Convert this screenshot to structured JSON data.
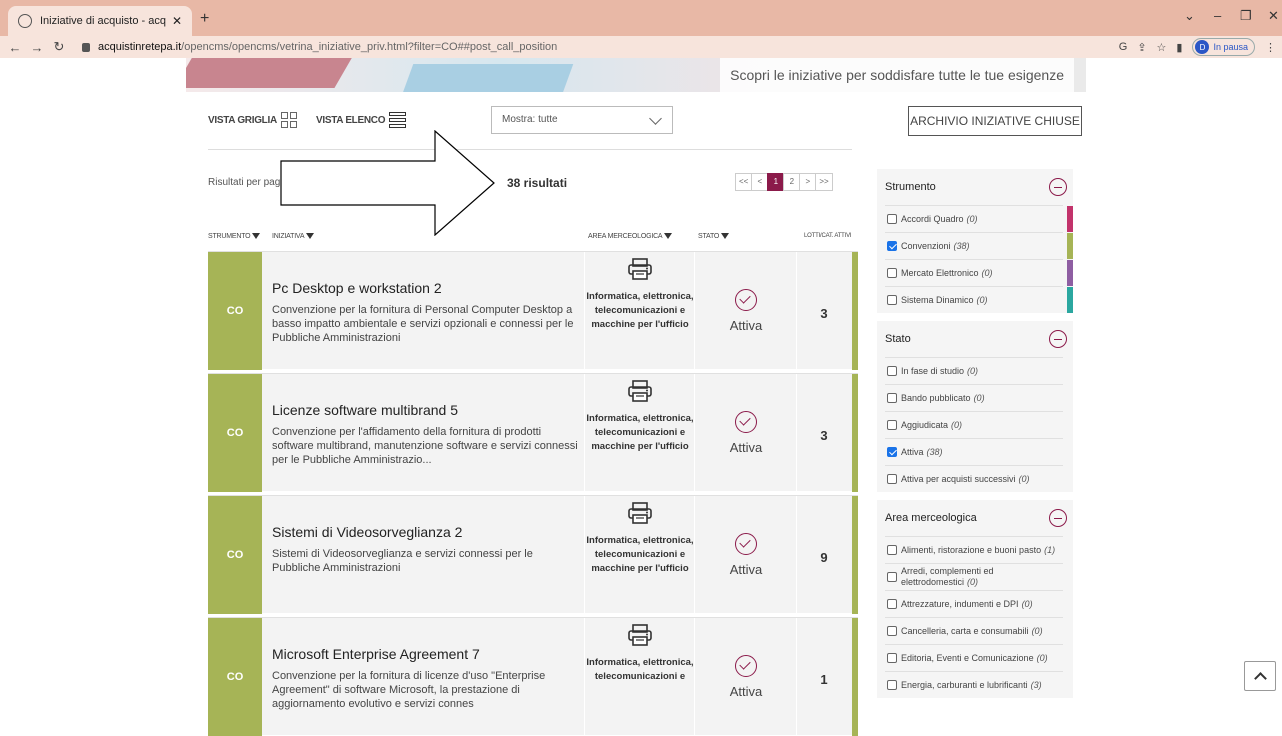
{
  "browser": {
    "tab_title": "Iniziative di acquisto - acquistinr",
    "tab_close": "✕",
    "new_tab": "+",
    "url_host": "acquistinretepa.it",
    "url_rest": "/opencms/opencms/vetrina_iniziative_priv.html?filter=CO##post_call_position",
    "profile_initial": "D",
    "profile_status": "In pausa"
  },
  "hero": {
    "text": "Scopri le iniziative per soddisfare tutte le tue esigenze"
  },
  "toolbar": {
    "vista_griglia": "VISTA GRIGLIA",
    "vista_elenco": "VISTA ELENCO",
    "mostra": "Mostra: tutte",
    "archivio": "ARCHIVIO INIZIATIVE CHIUSE"
  },
  "results": {
    "per_page": "Risultati per pagi",
    "count": "38 risultati",
    "pager": [
      "<<",
      "<",
      "1",
      "2",
      ">",
      ">>"
    ],
    "current_page": "1"
  },
  "table": {
    "headers": {
      "strumento": "STRUMENTO",
      "iniziativa": "INIZIATIVA",
      "area": "AREA MERCEOLOGICA",
      "stato": "STATO",
      "lotti": "LOTTI/CAT. ATTIVI"
    },
    "rows": [
      {
        "strumento": "CO",
        "title": "Pc Desktop e workstation 2",
        "desc": "Convenzione per la fornitura di Personal Computer Desktop a basso impatto ambientale e servizi opzionali e connessi per le Pubbliche Amministrazioni",
        "area": "Informatica, elettronica, telecomunicazioni e macchine per l'ufficio",
        "stato": "Attiva",
        "lotti": "3"
      },
      {
        "strumento": "CO",
        "title": "Licenze software multibrand 5",
        "desc": "Convenzione per l'affidamento della fornitura di prodotti software multibrand, manutenzione software e servizi connessi per le Pubbliche Amministrazio...",
        "area": "Informatica, elettronica, telecomunicazioni e macchine per l'ufficio",
        "stato": "Attiva",
        "lotti": "3"
      },
      {
        "strumento": "CO",
        "title": "Sistemi di Videosorveglianza 2",
        "desc": "Sistemi di Videosorveglianza e servizi connessi per le Pubbliche Amministrazioni",
        "area": "Informatica, elettronica, telecomunicazioni e macchine per l'ufficio",
        "stato": "Attiva",
        "lotti": "9"
      },
      {
        "strumento": "CO",
        "title": "Microsoft Enterprise Agreement 7",
        "desc": "Convenzione per la fornitura di licenze d'uso \"Enterprise Agreement\" di software Microsoft, la prestazione di aggiornamento evolutivo e servizi connes",
        "area": "Informatica, elettronica, telecomunicazioni e",
        "stato": "Attiva",
        "lotti": "1"
      }
    ]
  },
  "filters": {
    "strumento": {
      "title": "Strumento",
      "items": [
        {
          "label": "Accordi Quadro",
          "count": "(0)",
          "checked": false,
          "color": "#c2336b"
        },
        {
          "label": "Convenzioni",
          "count": "(38)",
          "checked": true,
          "color": "#a6b456"
        },
        {
          "label": "Mercato Elettronico",
          "count": "(0)",
          "checked": false,
          "color": "#8e5ea2"
        },
        {
          "label": "Sistema Dinamico",
          "count": "(0)",
          "checked": false,
          "color": "#2ba7a0"
        }
      ]
    },
    "stato": {
      "title": "Stato",
      "items": [
        {
          "label": "In fase di studio",
          "count": "(0)",
          "checked": false
        },
        {
          "label": "Bando pubblicato",
          "count": "(0)",
          "checked": false
        },
        {
          "label": "Aggiudicata",
          "count": "(0)",
          "checked": false
        },
        {
          "label": "Attiva",
          "count": "(38)",
          "checked": true
        },
        {
          "label": "Attiva per acquisti successivi",
          "count": "(0)",
          "checked": false
        }
      ]
    },
    "area": {
      "title": "Area merceologica",
      "items": [
        {
          "label": "Alimenti, ristorazione e buoni pasto",
          "count": "(1)",
          "checked": false
        },
        {
          "label": "Arredi, complementi ed elettrodomestici",
          "count": "(0)",
          "checked": false
        },
        {
          "label": "Attrezzature, indumenti e DPI",
          "count": "(0)",
          "checked": false
        },
        {
          "label": "Cancelleria, carta e consumabili",
          "count": "(0)",
          "checked": false
        },
        {
          "label": "Editoria, Eventi e Comunicazione",
          "count": "(0)",
          "checked": false
        },
        {
          "label": "Energia, carburanti e lubrificanti",
          "count": "(3)",
          "checked": false
        }
      ]
    }
  },
  "colors": {
    "accent": "#8b1a4a",
    "convenzione": "#a6b456",
    "tabbar": "#e8b8a6"
  }
}
